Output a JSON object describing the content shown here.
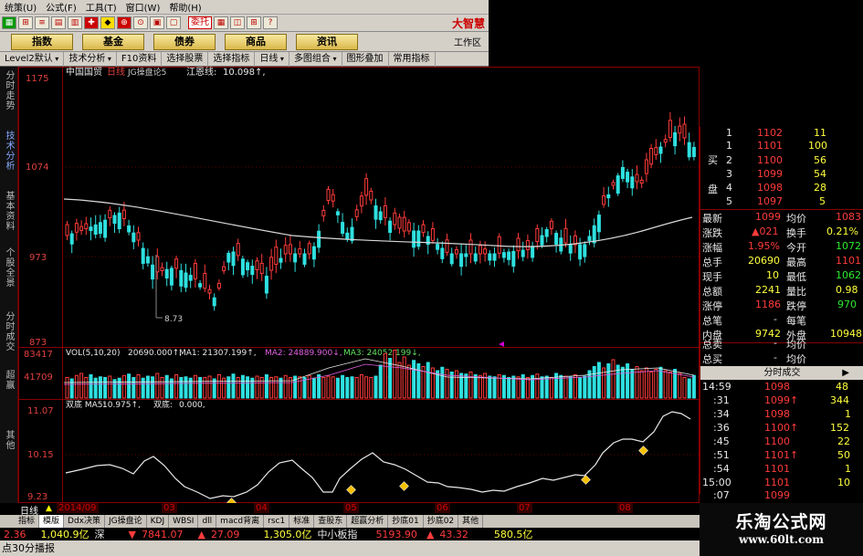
{
  "menubar": {
    "items": [
      "统策(",
      "公式(",
      "工具(",
      "窗口(",
      "帮助("
    ],
    "keys": [
      "U",
      "F",
      "T",
      "W",
      "H"
    ]
  },
  "toolbar": {
    "entrust_label": "委托",
    "brand": "大智慧"
  },
  "mainbar": {
    "buttons": [
      "指数",
      "基金",
      "债券",
      "商品",
      "资讯"
    ],
    "workspace": "工作区"
  },
  "subbar": {
    "items": [
      "Level2默认",
      "技术分析",
      "F10资料",
      "选择股票",
      "选择指标",
      "日线",
      "多图组合",
      "图形叠加",
      "常用指标"
    ]
  },
  "left_tabs": [
    "分时走势",
    "技术分析",
    "基本资料",
    "个股全景",
    "分时成交",
    "超赢",
    "其他"
  ],
  "chart_header": {
    "stock": "中国国贸",
    "period": "日线",
    "indicator": "JG操盘论5",
    "line_name": "江恩线:",
    "line_value": "10.098↑,"
  },
  "chart_data": {
    "type": "candlestick",
    "price_axis": [
      "1175",
      "1074",
      "973",
      "873"
    ],
    "low_mark": "8.73",
    "volume_axis": [
      "83417",
      "41709"
    ],
    "vol_label": "VOL(5,10,20)",
    "vol_value": "20690.000↑,",
    "ma1": "MA1: 21307.199↑,",
    "ma2": "MA2: 24889.900↓,",
    "ma3": "MA3: 24052.199↓,",
    "ind_axis": [
      "11.07",
      "10.15",
      "9.23"
    ],
    "ind_label": "双底 MA5:",
    "ind_ma5": "10.975↑,",
    "ind_double_bottom": "双底:",
    "ind_db_value": "0.000,",
    "volume": [
      30,
      28,
      33,
      36,
      30,
      34,
      29,
      31,
      30,
      32,
      27,
      29,
      33,
      35,
      30,
      34,
      29,
      32,
      31,
      36,
      30,
      33,
      28,
      34,
      30,
      31,
      29,
      33,
      30,
      30,
      32,
      28,
      34,
      29,
      31,
      35,
      30,
      33,
      31,
      29,
      32,
      30,
      34,
      30,
      31,
      29,
      33,
      30,
      32,
      31,
      30,
      33,
      29,
      34,
      30,
      32,
      31,
      29,
      33,
      30,
      31,
      30,
      34,
      31,
      30,
      32,
      48,
      65,
      58,
      70,
      52,
      60,
      48,
      55,
      50,
      46,
      52,
      44,
      40,
      45,
      42,
      38,
      40,
      36,
      35,
      38,
      34,
      33,
      36,
      32,
      31,
      34,
      33,
      30,
      32,
      31,
      34,
      30,
      33,
      35,
      31,
      32,
      30,
      36,
      33,
      32,
      31,
      34,
      30,
      32,
      40,
      46,
      52,
      44,
      50,
      56,
      48,
      45,
      50,
      42,
      46,
      40,
      44,
      38,
      42,
      45,
      40,
      38,
      42,
      36
    ]
  },
  "orderbook": {
    "side_buy_1": "买",
    "side_buy_2": "盘",
    "rows": [
      {
        "level": "1",
        "price": "1102",
        "vol": "11"
      },
      {
        "level": "1",
        "price": "1101",
        "vol": "100"
      },
      {
        "level": "2",
        "price": "1100",
        "vol": "56"
      },
      {
        "level": "3",
        "price": "1099",
        "vol": "54"
      },
      {
        "level": "4",
        "price": "1098",
        "vol": "28"
      },
      {
        "level": "5",
        "price": "1097",
        "vol": "5"
      }
    ]
  },
  "stats": {
    "latest_l": "最新",
    "latest_v": "1099",
    "avg_l": "均价",
    "avg_v": "1083",
    "change_l": "涨跌",
    "change_v": "▲021",
    "turnover_l": "换手",
    "turnover_v": "0.21%",
    "pct_l": "涨幅",
    "pct_v": "1.95%",
    "open_l": "今开",
    "open_v": "1072",
    "total_l": "总手",
    "total_v": "20690",
    "high_l": "最高",
    "high_v": "1101",
    "cur_l": "现手",
    "cur_v": "10",
    "low_l": "最低",
    "low_v": "1062",
    "amount_l": "总额",
    "amount_v": "2241",
    "ratio_l": "量比",
    "ratio_v": "0.98",
    "limitup_l": "涨停",
    "limitup_v": "1186",
    "limitdown_l": "跌停",
    "limitdown_v": "970",
    "strokes_l": "总笔",
    "strokes_v": "-",
    "perstroke_l": "每笔",
    "perstroke_v": "",
    "inner_l": "内盘",
    "inner_v": "9742",
    "outer_l": "外盘",
    "outer_v": "10948",
    "sell_l": "总卖",
    "sell_v": "-",
    "sell_avg_l": "均价",
    "sell_avg_v": "",
    "buy_l": "总买",
    "buy_v": "-",
    "buy_avg_l": "均价",
    "buy_avg_v": ""
  },
  "trades": {
    "header": "分时成交",
    "arrow": "▶",
    "rows": [
      {
        "time": "14:59",
        "price": "1098",
        "vol": "48"
      },
      {
        "time": ":31",
        "price": "1099↑",
        "vol": "344"
      },
      {
        "time": ":34",
        "price": "1098",
        "vol": "1"
      },
      {
        "time": ":36",
        "price": "1100↑",
        "vol": "152"
      },
      {
        "time": ":45",
        "price": "1100",
        "vol": "22"
      },
      {
        "time": ":51",
        "price": "1101↑",
        "vol": "50"
      },
      {
        "time": ":54",
        "price": "1101",
        "vol": "1"
      },
      {
        "time": "15:00",
        "price": "1101",
        "vol": "10"
      },
      {
        "time": ":07",
        "price": "1099",
        "vol": ""
      }
    ]
  },
  "periodbar": {
    "daily": "日线",
    "ticks": [
      "2014/09",
      "03",
      "04",
      "05",
      "06",
      "07",
      "08"
    ]
  },
  "indicator_tabs": [
    "指标",
    "模版",
    "Ddx决策",
    "JG操盘论",
    "KDJ",
    "WBSI",
    "dll",
    "macd背离",
    "rsc1",
    "标准",
    "查股东",
    "超赢分析",
    "抄底01",
    "抄底02",
    "其他"
  ],
  "tickerbar": {
    "a": "2.36",
    "b": "1,040.9亿",
    "c": "深",
    "d": "▼",
    "e": "7841.07",
    "f": "▲",
    "g": "27.09",
    "h": "1,305.0亿",
    "i": "中小板指",
    "j": "5193.90",
    "k": "▲",
    "l": "43.32",
    "m": "580.5亿"
  },
  "statusbar": {
    "text": "点30分播报"
  },
  "watermark": {
    "title": "乐淘公式网",
    "url": "www.60lt.com"
  }
}
